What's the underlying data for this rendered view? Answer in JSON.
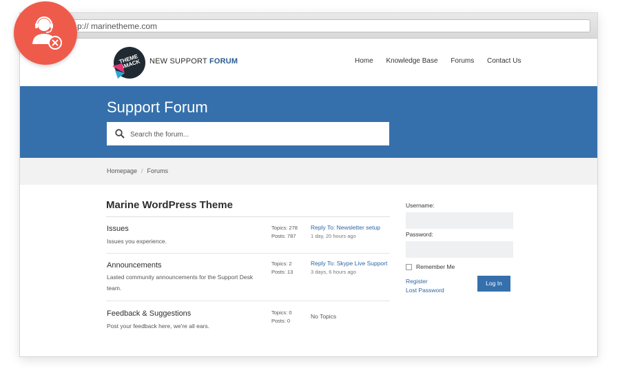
{
  "browser": {
    "url": "p:// marinetheme.com"
  },
  "brand": {
    "logo_text": "THEME SMACK",
    "title_prefix": "NEW SUPPORT",
    "title_bold": "FORUM"
  },
  "nav": {
    "items": [
      "Home",
      "Knowledge Base",
      "Forums",
      "Contact Us"
    ]
  },
  "hero": {
    "title": "Support Forum",
    "search_placeholder": "Search the forum..."
  },
  "breadcrumb": {
    "home": "Homepage",
    "separator": "/",
    "current": "Forums"
  },
  "forum": {
    "title": "Marine WordPress Theme",
    "rows": [
      {
        "name": "Issues",
        "description": "Issues you experience.",
        "topics": "Topics: 278",
        "posts": "Posts: 787",
        "last_reply": "Reply To: Newsletter setup",
        "last_time": "1 day, 20 hours ago"
      },
      {
        "name": "Announcements",
        "description": "Lasted community announcements for the Support Desk team.",
        "topics": "Topics: 2",
        "posts": "Posts: 13",
        "last_reply": "Reply To: Skype Live Support",
        "last_time": "3 days, 6 hours ago"
      },
      {
        "name": "Feedback & Suggestions",
        "description": "Post your feedback here, we're all ears.",
        "topics": "Topics: 0",
        "posts": "Posts: 0",
        "last_reply": "No Topics",
        "last_time": ""
      }
    ]
  },
  "login": {
    "username_label": "Username:",
    "password_label": "Password:",
    "remember_label": "Remember Me",
    "register_label": "Register",
    "lost_password_label": "Lost Password",
    "login_button": "Log In"
  },
  "colors": {
    "accent": "#3570ad",
    "badge": "#ef5b4b",
    "link": "#2d65a5"
  }
}
